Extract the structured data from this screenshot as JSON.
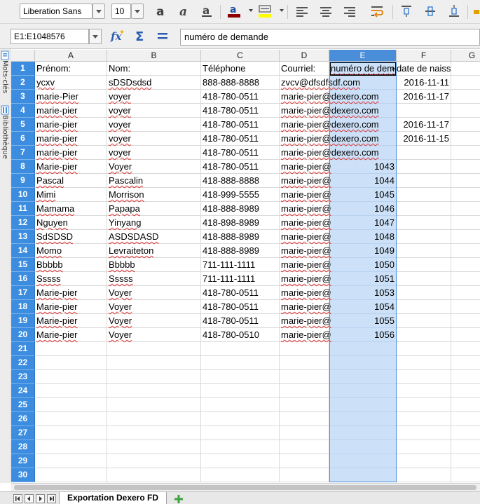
{
  "toolbar": {
    "font_name": "Liberation Sans",
    "font_size": "10",
    "font_color": "#8b0000",
    "highlight_color": "#ffff00",
    "icons": [
      "bold-icon",
      "italic-icon",
      "underline-icon",
      "font-color-icon",
      "highlight-icon",
      "align-left-icon",
      "align-center-icon",
      "align-right-icon",
      "wrap-text-icon",
      "align-top-icon",
      "align-middle-icon",
      "align-bottom-icon"
    ]
  },
  "formula_bar": {
    "name_box": "E1:E1048576",
    "content": "numéro de demande",
    "icons": [
      "function-wizard-icon",
      "sum-icon",
      "formula-icon"
    ]
  },
  "side_panel": {
    "tabs": [
      "Mots-clés",
      "Bibliothèque"
    ]
  },
  "columns": [
    "A",
    "B",
    "C",
    "D",
    "E",
    "F",
    "G"
  ],
  "selected_column": "E",
  "row_count": 30,
  "rows": [
    [
      "Prénom:",
      "Nom:",
      "Téléphone",
      "Courriel:",
      "numéro de dem",
      "date de naissance"
    ],
    [
      "ycxv",
      "sDSDsdsd",
      "888-888-8888",
      "zvcv@dfsdfsdf.com",
      "",
      "2016-11-11"
    ],
    [
      "marie-Pier",
      "voyer",
      "418-780-0511",
      "marie-pier@dexero.com",
      "",
      "2016-11-17"
    ],
    [
      "marie-pier",
      "voyer",
      "418-780-0511",
      "marie-pier@dexero.com",
      "",
      ""
    ],
    [
      "marie-pier",
      "voyer",
      "418-780-0511",
      "marie-pier@dexero.com",
      "",
      "2016-11-17"
    ],
    [
      "marie-pier",
      "voyer",
      "418-780-0511",
      "marie-pier@dexero.com",
      "",
      "2016-11-15"
    ],
    [
      "marie-pier",
      "voyer",
      "418-780-0511",
      "marie-pier@dexero.com",
      "",
      ""
    ],
    [
      "Marie-pier",
      "Voyer",
      "418-780-0511",
      "marie-pier@",
      "1043",
      ""
    ],
    [
      "Pascal",
      "Pascalin",
      "418-888-8888",
      "marie-pier@",
      "1044",
      ""
    ],
    [
      "Mimi",
      "Morrison",
      "418-999-5555",
      "marie-pier@",
      "1045",
      ""
    ],
    [
      "Mamama",
      "Papapa",
      "418-888-8989",
      "marie-pier@",
      "1046",
      ""
    ],
    [
      "Nguyen",
      "Yinyang",
      "418-898-8989",
      "marie-pier@",
      "1047",
      ""
    ],
    [
      "SdSDSD",
      "ASDSDASD",
      "418-888-8989",
      "marie-pier@",
      "1048",
      ""
    ],
    [
      "Momo",
      "Levraiteton",
      "418-888-8989",
      "marie-pier@",
      "1049",
      ""
    ],
    [
      "Bbbbb",
      "Bbbbb",
      "711-111-1111",
      "marie-pier@",
      "1050",
      ""
    ],
    [
      "Sssss",
      "Sssss",
      "711-111-1111",
      "marie-pier@",
      "1051",
      ""
    ],
    [
      "Marie-pier",
      "Voyer",
      "418-780-0511",
      "marie-pier@",
      "1053",
      ""
    ],
    [
      "Marie-pier",
      "Voyer",
      "418-780-0511",
      "marie-pier@",
      "1054",
      ""
    ],
    [
      "Marie-pier",
      "Voyer",
      "418-780-0511",
      "marie-pier@",
      "1055",
      ""
    ],
    [
      "Marie-pier",
      "Voyer",
      "418-780-0510",
      "marie-pier@",
      "1056",
      ""
    ]
  ],
  "sheet_tabs": {
    "active": "Exportation Dexero FD"
  },
  "colors": {
    "row_header": "#3c8de0",
    "selected_column_header": "#4a8ed9",
    "selected_cells": "#cce1f8",
    "spell_underline": "#dd3333"
  }
}
